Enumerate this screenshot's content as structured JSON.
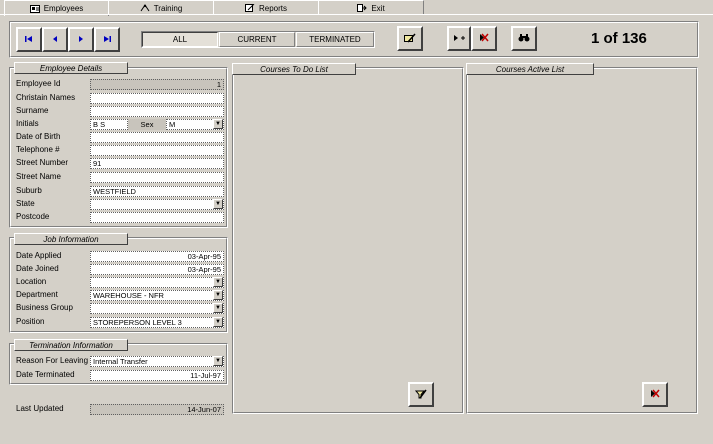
{
  "tabs": [
    {
      "label": "Employees",
      "icon": "employees-icon"
    },
    {
      "label": "Training",
      "icon": "training-icon"
    },
    {
      "label": "Reports",
      "icon": "reports-icon"
    },
    {
      "label": "Exit",
      "icon": "exit-icon"
    }
  ],
  "toolbar": {
    "filters": [
      "ALL",
      "CURRENT",
      "TERMINATED"
    ],
    "record_counter": "1 of 136"
  },
  "employee_details": {
    "title": "Employee Details",
    "labels": {
      "employee_id": "Employee Id",
      "christian_names": "Christain Names",
      "surname": "Surname",
      "initials": "Initials",
      "sex": "Sex",
      "dob": "Date of Birth",
      "telephone": "Telephone #",
      "street_number": "Street Number",
      "street_name": "Street Name",
      "suburb": "Suburb",
      "state": "State",
      "postcode": "Postcode"
    },
    "values": {
      "employee_id": "1",
      "christian_names": "",
      "surname": "",
      "initials": "B S",
      "sex": "M",
      "dob": "",
      "telephone": "",
      "street_number": "91",
      "street_name": "",
      "suburb": "WESTFIELD",
      "state": "",
      "postcode": ""
    }
  },
  "job_information": {
    "title": "Job Information",
    "labels": {
      "date_applied": "Date Applied",
      "date_joined": "Date Joined",
      "location": "Location",
      "department": "Department",
      "business_group": "Business Group",
      "position": "Position"
    },
    "values": {
      "date_applied": "03-Apr-95",
      "date_joined": "03-Apr-95",
      "location": "",
      "department": "WAREHOUSE - NFR",
      "business_group": "",
      "position": "STOREPERSON LEVEL 3"
    }
  },
  "termination_information": {
    "title": "Termination Information",
    "labels": {
      "reason": "Reason For Leaving",
      "date_terminated": "Date Terminated"
    },
    "values": {
      "reason": "Internal Transfer",
      "date_terminated": "11-Jul-97"
    }
  },
  "last_updated": {
    "label": "Last Updated",
    "value": "14-Jun-07"
  },
  "courses_todo": {
    "title": "Courses To Do List"
  },
  "courses_active": {
    "title": "Courses Active List"
  },
  "colors": {
    "nav_blue": "#0000c0",
    "delete_red": "#c00000",
    "window_bg": "#d4d0c8"
  }
}
